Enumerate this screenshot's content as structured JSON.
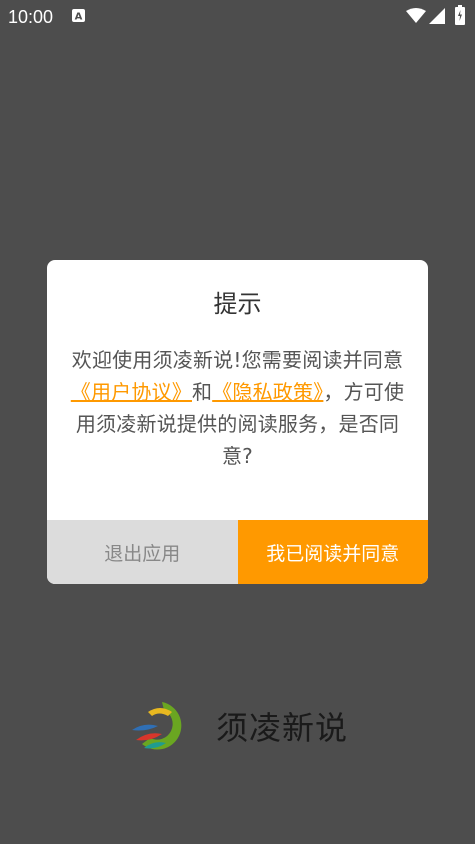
{
  "status_bar": {
    "time": "10:00",
    "indicator_glyph": "A",
    "icons": [
      "a-notification-icon",
      "wifi-icon",
      "signal-icon",
      "battery-icon"
    ]
  },
  "dialog": {
    "title": "提示",
    "message_parts": {
      "prefix": "欢迎使用须凌新说!您需要阅读并同意",
      "link_user_agreement": "《用户协议》",
      "middle": "和",
      "link_privacy_policy": "《隐私政策》",
      "suffix": "，方可使用须凌新说提供的阅读服务，是否同意?"
    },
    "buttons": {
      "exit": "退出应用",
      "agree": "我已阅读并同意"
    }
  },
  "brand": {
    "app_name": "须凌新说",
    "logo_icon": "app-logo-icon"
  },
  "colors": {
    "background": "#4d4d4d",
    "accent": "#ff9900",
    "exit_button_bg": "#dcdcdc",
    "exit_button_text": "#888888",
    "dialog_bg": "#ffffff"
  }
}
